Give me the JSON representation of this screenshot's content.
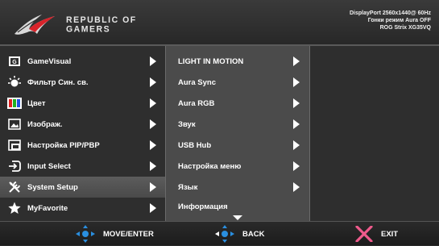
{
  "header": {
    "brand_line1": "REPUBLIC OF",
    "brand_line2": "GAMERS",
    "status": [
      "DisplayPort 2560x1440@ 60Hz",
      "Гонки режим Aura OFF",
      "ROG Strix XG35VQ"
    ]
  },
  "main_menu": {
    "items": [
      {
        "label": "GameVisual",
        "icon": "gamevisual-icon"
      },
      {
        "label": "Фильтр Син. св.",
        "icon": "blue-light-filter-icon"
      },
      {
        "label": "Цвет",
        "icon": "color-icon"
      },
      {
        "label": "Изображ.",
        "icon": "image-icon"
      },
      {
        "label": "Настройка PIP/PBP",
        "icon": "pip-pbp-icon"
      },
      {
        "label": "Input Select",
        "icon": "input-select-icon"
      },
      {
        "label": "System Setup",
        "icon": "system-setup-icon"
      },
      {
        "label": "MyFavorite",
        "icon": "star-icon"
      }
    ],
    "selected_index": 6
  },
  "submenu": {
    "items": [
      {
        "label": "LIGHT IN MOTION",
        "has_arrow": true
      },
      {
        "label": "Aura Sync",
        "has_arrow": true
      },
      {
        "label": "Aura RGB",
        "has_arrow": true
      },
      {
        "label": "Звук",
        "has_arrow": true
      },
      {
        "label": "USB Hub",
        "has_arrow": true
      },
      {
        "label": "Настройка меню",
        "has_arrow": true
      },
      {
        "label": "Язык",
        "has_arrow": true
      },
      {
        "label": "Информация",
        "has_arrow": false
      }
    ]
  },
  "footer": {
    "move_label": "MOVE/ENTER",
    "back_label": "BACK",
    "exit_label": "EXIT"
  },
  "colors": {
    "accent_blue": "#2a8fe0",
    "exit_pink": "#f05a8c",
    "brand_red": "#d8232a"
  }
}
